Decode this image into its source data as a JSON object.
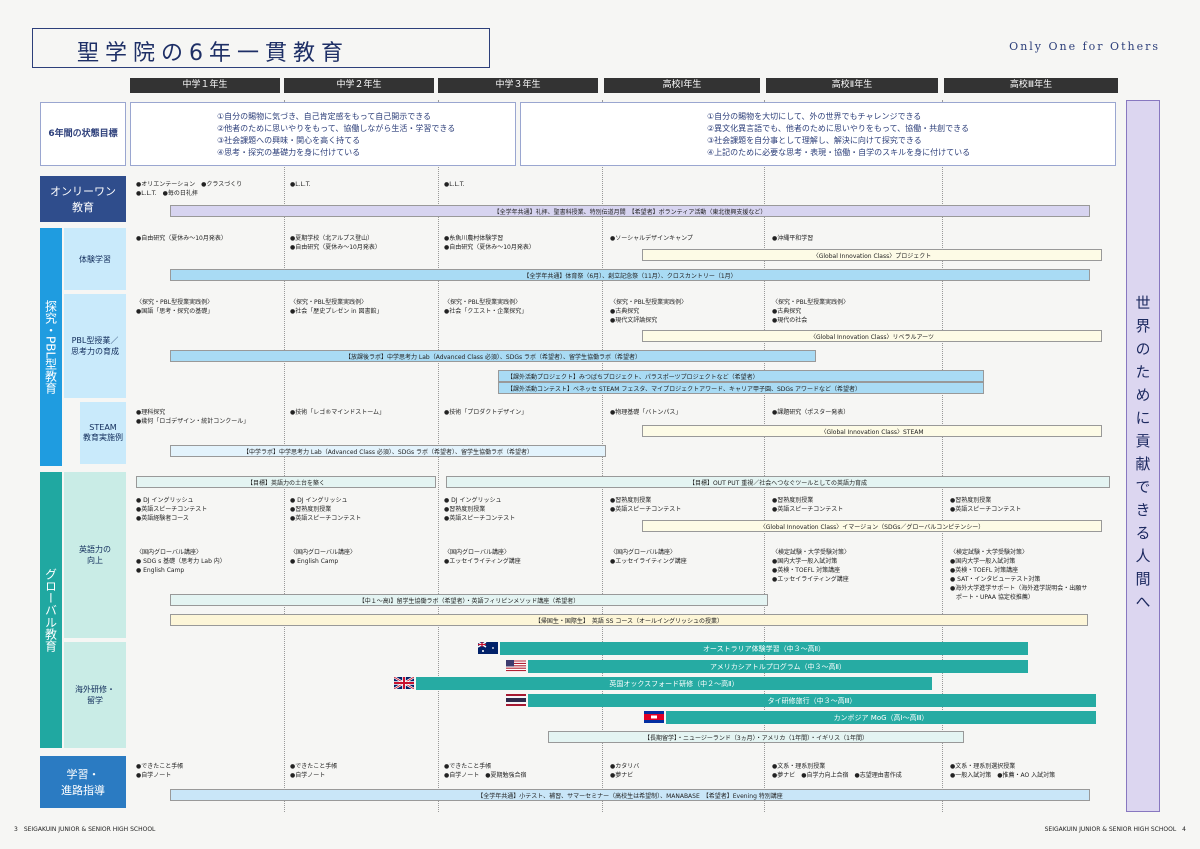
{
  "header": {
    "title": "聖学院の6年一貫教育",
    "tagline": "Only One for Others",
    "grades": [
      "中学１年生",
      "中学２年生",
      "中学３年生",
      "高校Ⅰ年生",
      "高校Ⅱ年生",
      "高校Ⅲ年生"
    ]
  },
  "goals": {
    "label": "6年間の状態目標",
    "jh": "①自分の賜物に気づき、自己肯定感をもって自己開示できる\n②他者のために思いやりをもって、協働しながら生活・学習できる\n③社会課題への興味・関心を高く持てる\n④思考・探究の基礎力を身に付けている",
    "hs": "①自分の賜物を大切にして、外の世界でもチャレンジできる\n②異文化異言語でも、他者のために思いやりをもって、協働・共創できる\n③社会課題を自分事として理解し、解決に向けて探究できる\n④上記のために必要な思考・表現・協働・自学のスキルを身に付けている"
  },
  "vertical": "世界のために貢献できる人間へ",
  "cats": {
    "onlyone": "オンリーワン\n教育",
    "inquiry": "探究・PBL型教育",
    "global": "グローバル教育",
    "career": "学習・\n進路指導"
  },
  "subs": {
    "exp": "体験学習",
    "pbl": "PBL型授業／\n思考力の育成",
    "steam": "STEAM\n教育実施例",
    "eng": "英語力の\n向上",
    "abroad": "海外研修・\n留学"
  },
  "cells": {
    "o1": "●オリエンテーション　●クラスづくり\n●L.L.T.　●毎の日礼拝",
    "o2": "●L.L.T.",
    "o3": "●L.L.T.",
    "e1": "●自由研究（夏休み～10月発表）",
    "e2": "●夏期学校（北アルプス登山）\n●自由研究（夏休み～10月発表）",
    "e3": "●糸魚川農村体験学習\n●自由研究（夏休み～10月発表）",
    "e4": "●ソーシャルデザインキャンプ",
    "e5": "●沖縄平和学習",
    "p1": "〈探究・PBL型授業実践例〉\n●国語「思考・探究の基礎」",
    "p2": "〈探究・PBL型授業実践例〉\n●社会「歴史プレゼン in 図書館」",
    "p3": "〈探究・PBL型授業実践例〉\n●社会「クエスト・企業探究」",
    "p4": "〈探究・PBL型授業実践例〉\n●古典探究\n●現代文評論探究",
    "p5": "〈探究・PBL型授業実践例〉\n●古典探究\n●現代の社会",
    "s1": "●理科探究\n●幾何「ロゴデザイン・統計コンクール」",
    "s2": "●技術「レゴ®マインドストーム」",
    "s3": "●技術「プロダクトデザイン」",
    "s4": "●物理基礎「バトンパス」",
    "s5": "●課題研究（ポスター発表）",
    "g1": "● DJ イングリッシュ\n●英語スピーチコンテスト\n●英語経験者コース",
    "g2": "● DJ イングリッシュ\n●習熟度別授業\n●英語スピーチコンテスト",
    "g3": "● DJ イングリッシュ\n●習熟度別授業\n●英語スピーチコンテスト",
    "g4": "●習熟度別授業\n●英語スピーチコンテスト",
    "g5": "●習熟度別授業\n●英語スピーチコンテスト",
    "g6": "●習熟度別授業\n●英語スピーチコンテスト",
    "h1": "〈国内グローバル講座〉\n● SDG s 基礎（思考力 Lab 内）\n● English Camp",
    "h2": "〈国内グローバル講座〉\n● English Camp",
    "h3": "〈国内グローバル講座〉\n●エッセイライティング講座",
    "h4": "〈国内グローバル講座〉\n●エッセイライティング講座",
    "h5": "〈検定試験・大学受験対策〉\n●国内大学一般入試対策\n●英検・TOEFL 対策講座\n●エッセイライティング講座",
    "h6": "〈検定試験・大学受験対策〉\n●国内大学一般入試対策\n●英検・TOEFL 対策講座\n● SAT・インタビューテスト対策\n●海外大学進学サポート（海外進学説明会・出願サ\n　ポート・UPAA 協定校推薦）",
    "c1": "●できたこと手帳\n●自学ノート",
    "c2": "●できたこと手帳\n●自学ノート",
    "c3": "●できたこと手帳\n●自学ノート　●夏期勉強合宿",
    "c4": "●カタリバ\n●夢ナビ",
    "c5": "●文系・理系別授業\n●夢ナビ　●自学力向上合宿　●志望理由書作成",
    "c6": "●文系・理系別選択授業\n●一般入試対策　●推薦・AO 入試対策"
  },
  "bars": {
    "b1": "【全学年共通】礼拝、聖書科授業、特別伝道月間　【希望者】ボランティア活動（東北復興支援など）",
    "b2": "〈Global Innovation Class〉プロジェクト",
    "b3": "【全学年共通】体育祭（6月）、創立記念祭（11月）、クロスカントリー（1月）",
    "b4": "〈Global Innovation Class〉リベラルアーツ",
    "b5": "【放課後ラボ】中学思考力 Lab（Advanced Class 必須）、SDGs ラボ（希望者）、留学生協働ラボ（希望者）",
    "b6": "【課外活動プロジェクト】みつばちプロジェクト、パラスポーツプロジェクトなど（希望者）",
    "b7": "【課外活動コンテスト】ベネッセ STEAM フェスタ、マイプロジェクトアワード、キャリア甲子園、SDGs アワードなど（希望者）",
    "b8": "〈Global Innovation Class〉STEAM",
    "b9": "【中学ラボ】中学思考力 Lab（Advanced Class 必須）、SDGs ラボ（希望者）、留学生協働ラボ（希望者）",
    "b10": "【目標】英語力の土台を築く",
    "b11": "【目標】OUT PUT 重視／社会へつなぐツールとしての英語力育成",
    "b12": "〈Global Innovation Class〉イマージョン（SDGs／グローバルコンピテンシー）",
    "b13": "【中１～高Ⅰ】留学生協働ラボ（希望者）・英語フィリピンメソッド講座（希望者）",
    "b14": "【帰国生・国際生】　英語 SS コース（オールイングリッシュの授業）",
    "t1": "オーストラリア体験学習（中３～高Ⅱ）",
    "t2": "アメリカシアトルプログラム（中３～高Ⅱ）",
    "t3": "英国オックスフォード研修（中２～高Ⅱ）",
    "t4": "タイ研修旅行（中３～高Ⅲ）",
    "t5": "カンボジア MoG（高Ⅰ～高Ⅲ）",
    "b15": "【長期留学】・ニュージーランド（3ヵ月）・アメリカ（1年間）・イギリス（1年間）",
    "b16": "【全学年共通】小テスト、補習、サマーセミナー（高校生は希望制）、MANABASE　【希望者】Evening 特別講座"
  },
  "footer": {
    "left": "3　SEIGAKUIN JUNIOR & SENIOR HIGH SCHOOL",
    "right": "SEIGAKUIN JUNIOR & SENIOR HIGH SCHOOL　4"
  }
}
